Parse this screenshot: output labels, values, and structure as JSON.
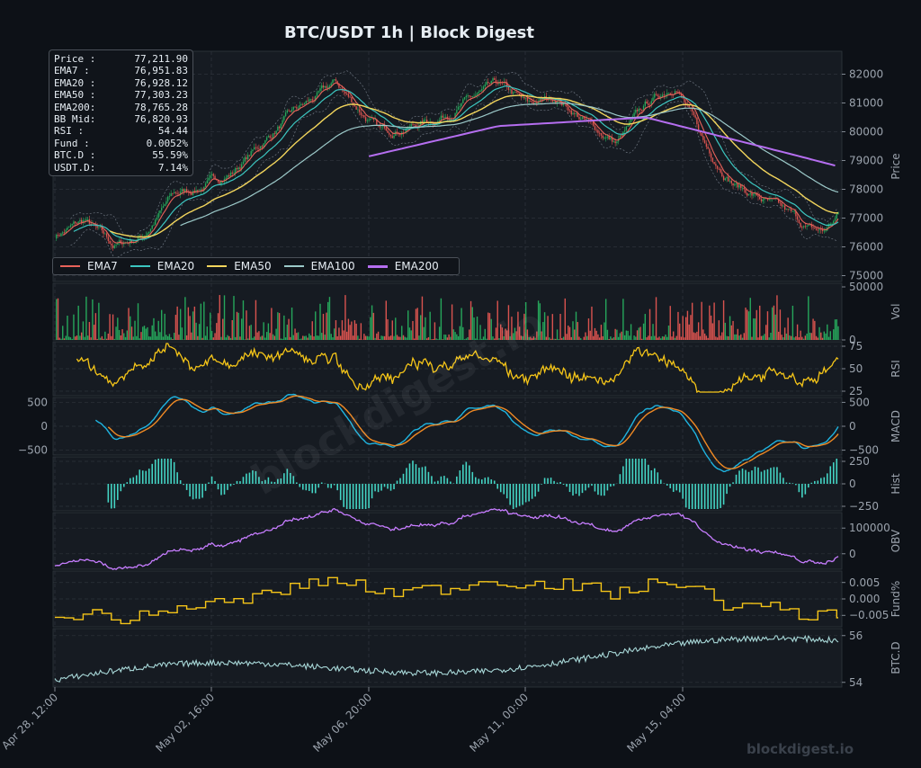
{
  "title": "BTC/USDT  1h  |  Block Digest",
  "watermark": "blockdigest.io",
  "footer_brand": "blockdigest.io",
  "colors": {
    "background": "#0d1117",
    "panel": "#161b22",
    "grid": "#2d333b",
    "axis_text": "#9ba3ad",
    "candle_up": "#26a65b",
    "candle_down": "#d9534f",
    "ema7": "#e8625a",
    "ema20": "#3cc6c0",
    "ema50": "#f2d55c",
    "ema100": "#9cc9c9",
    "ema200": "#b56ef0",
    "rsi": "#f5c518",
    "macd": "#1fb4e0",
    "signal": "#f08a24",
    "hist": "#44d4c4",
    "obv": "#c77dff",
    "fund": "#f5c518",
    "btcd": "#a8d8d8"
  },
  "info_box": [
    {
      "label": "Price :",
      "value": "77,211.90"
    },
    {
      "label": "EMA7  :",
      "value": "76,951.83"
    },
    {
      "label": "EMA20 :",
      "value": "76,928.12"
    },
    {
      "label": "EMA50 :",
      "value": "77,303.23"
    },
    {
      "label": "EMA200:",
      "value": "78,765.28"
    },
    {
      "label": "BB Mid:",
      "value": "76,820.93"
    },
    {
      "label": "RSI   :",
      "value": "54.44"
    },
    {
      "label": "Fund  :",
      "value": "0.0052%"
    },
    {
      "label": "BTC.D :",
      "value": "55.59%"
    },
    {
      "label": "USDT.D:",
      "value": "7.14%"
    }
  ],
  "legend": [
    "EMA7",
    "EMA20",
    "EMA50",
    "EMA100",
    "EMA200"
  ],
  "x_ticks": [
    "Apr 28, 12:00",
    "May 02, 16:00",
    "May 06, 20:00",
    "May 11, 00:00",
    "May 15, 04:00"
  ],
  "panels": {
    "price": {
      "label": "Price",
      "ticks": [
        "82000",
        "81000",
        "80000",
        "79000",
        "78000",
        "77000",
        "76000",
        "75000"
      ]
    },
    "vol": {
      "label": "Vol",
      "ticks": [
        "50000",
        "0"
      ]
    },
    "rsi": {
      "label": "RSI",
      "ticks": [
        "75",
        "50",
        "25"
      ]
    },
    "macd": {
      "label": "MACD",
      "ticks_right": [
        "500",
        "0",
        "−500"
      ],
      "ticks_left": [
        "500",
        "0",
        "−500"
      ]
    },
    "hist": {
      "label": "Hist",
      "ticks": [
        "250",
        "0",
        "−250"
      ]
    },
    "obv": {
      "label": "OBV",
      "ticks": [
        "100000",
        "0"
      ]
    },
    "fund": {
      "label": "Fund%",
      "ticks": [
        "0.005",
        "0.000",
        "−0.005"
      ]
    },
    "btcd": {
      "label": "BTC.D",
      "ticks": [
        "56",
        "54"
      ]
    }
  },
  "chart_data": {
    "type": "line",
    "title": "BTC/USDT  1h  |  Block Digest",
    "x_range": [
      "Apr 28, 12:00",
      "May 19, 12:00"
    ],
    "price_series": {
      "name": "Price",
      "points": [
        [
          0,
          76400
        ],
        [
          4,
          76900
        ],
        [
          8,
          76000
        ],
        [
          12,
          76400
        ],
        [
          16,
          77800
        ],
        [
          20,
          78100
        ],
        [
          24,
          78600
        ],
        [
          28,
          79600
        ],
        [
          32,
          80600
        ],
        [
          36,
          81300
        ],
        [
          38,
          81700
        ],
        [
          40,
          81100
        ],
        [
          44,
          80000
        ],
        [
          48,
          80200
        ],
        [
          52,
          80500
        ],
        [
          56,
          81100
        ],
        [
          60,
          81600
        ],
        [
          64,
          80900
        ],
        [
          68,
          81200
        ],
        [
          72,
          80300
        ],
        [
          76,
          79600
        ],
        [
          80,
          80900
        ],
        [
          84,
          81700
        ],
        [
          88,
          79500
        ],
        [
          92,
          78200
        ],
        [
          96,
          77600
        ],
        [
          100,
          77000
        ],
        [
          102,
          76600
        ],
        [
          104,
          76500
        ],
        [
          106,
          77100
        ]
      ]
    },
    "ema200_series": {
      "name": "EMA200",
      "points": [
        [
          40,
          79000
        ],
        [
          60,
          80200
        ],
        [
          80,
          80500
        ],
        [
          100,
          79200
        ],
        [
          106,
          78800
        ]
      ]
    },
    "ylim_price": [
      75000,
      82800
    ],
    "ylim_vol": [
      0,
      50000
    ],
    "ylim_rsi": [
      20,
      80
    ],
    "ylim_macd": [
      -600,
      600
    ],
    "ylim_fund": [
      -0.008,
      0.008
    ],
    "ylim_btcd": [
      53.8,
      56.3
    ]
  }
}
